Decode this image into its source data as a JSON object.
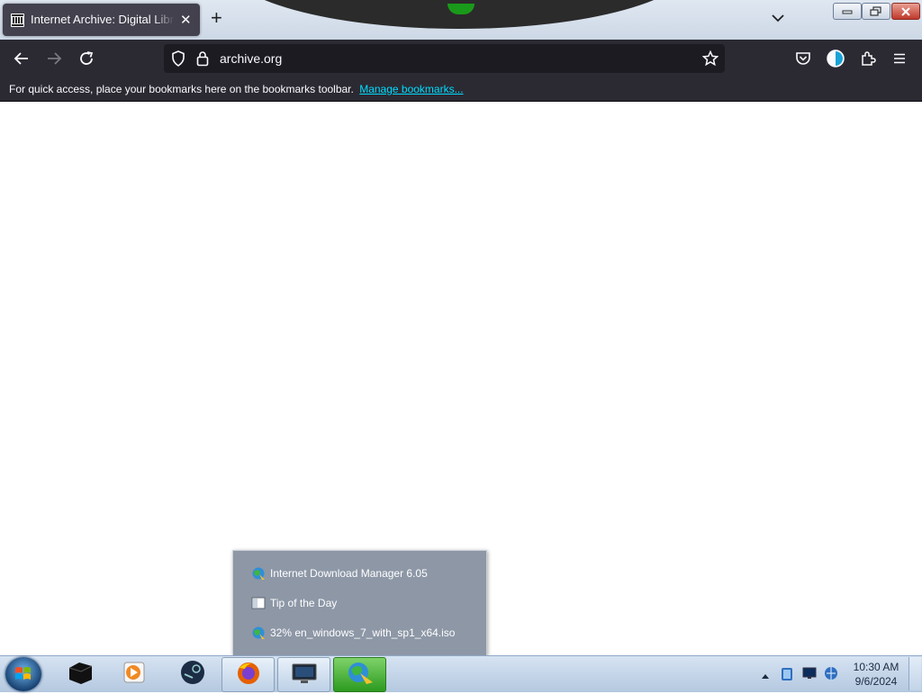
{
  "browser": {
    "tab": {
      "title": "Internet Archive: Digital Library",
      "icon": "archive-building-icon"
    },
    "url": "archive.org",
    "bookmarks_bar": {
      "message": "For quick access, place your bookmarks here on the bookmarks toolbar.",
      "link": "Manage bookmarks..."
    }
  },
  "popup_menu": {
    "items": [
      {
        "label": "Internet Download Manager 6.05",
        "icon": "idm-globe-icon"
      },
      {
        "label": "Tip of the Day",
        "icon": "tip-icon"
      },
      {
        "label": "32% en_windows_7_with_sp1_x64.iso",
        "icon": "idm-globe-icon"
      }
    ]
  },
  "taskbar": {
    "apps": [
      "dark-box-app-icon",
      "media-player-icon",
      "steam-like-icon",
      "firefox-icon",
      "monitor-app-icon",
      "idm-icon"
    ],
    "clock": {
      "time": "10:30 AM",
      "date": "9/6/2024"
    }
  },
  "colors": {
    "toolbar": "#2b2a33",
    "urlbar": "#1c1b22",
    "link": "#00ddff",
    "popup": "#8d97a6"
  }
}
